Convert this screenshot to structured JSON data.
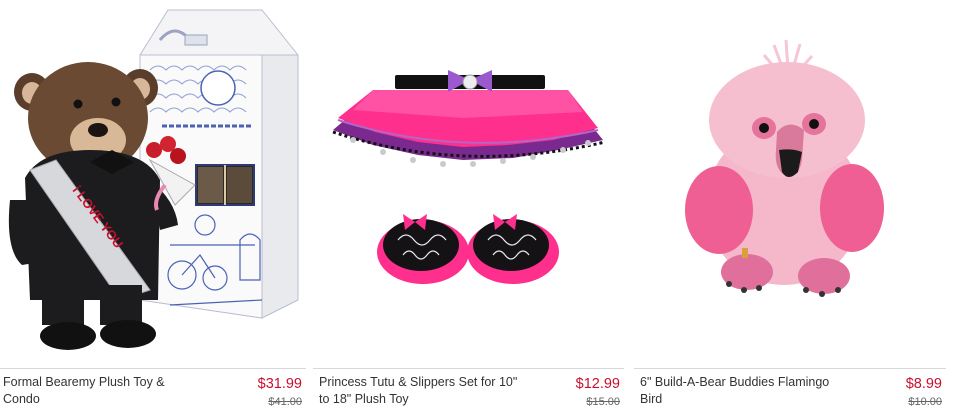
{
  "products": [
    {
      "name": "Formal Bearemy Plush Toy & Condo",
      "price": "$31.99",
      "was_price": "$41.00",
      "image": "bear-with-condo-box-image",
      "box_text": "Where Best Friends are Made",
      "box_logo": "Build-A-Bear Workshop",
      "sash_text": "I LOVE YOU"
    },
    {
      "name": "Princess Tutu & Slippers Set for 10\" to 18\" Plush Toy",
      "price": "$12.99",
      "was_price": "$15.00",
      "image": "tutu-and-slippers-image"
    },
    {
      "name": "6\" Build-A-Bear Buddies Flamingo Bird",
      "price": "$8.99",
      "was_price": "$10.00",
      "image": "flamingo-plush-image"
    }
  ],
  "colors": {
    "sale_price": "#c8102e",
    "was_price": "#666666",
    "divider": "#d8d8d8"
  }
}
